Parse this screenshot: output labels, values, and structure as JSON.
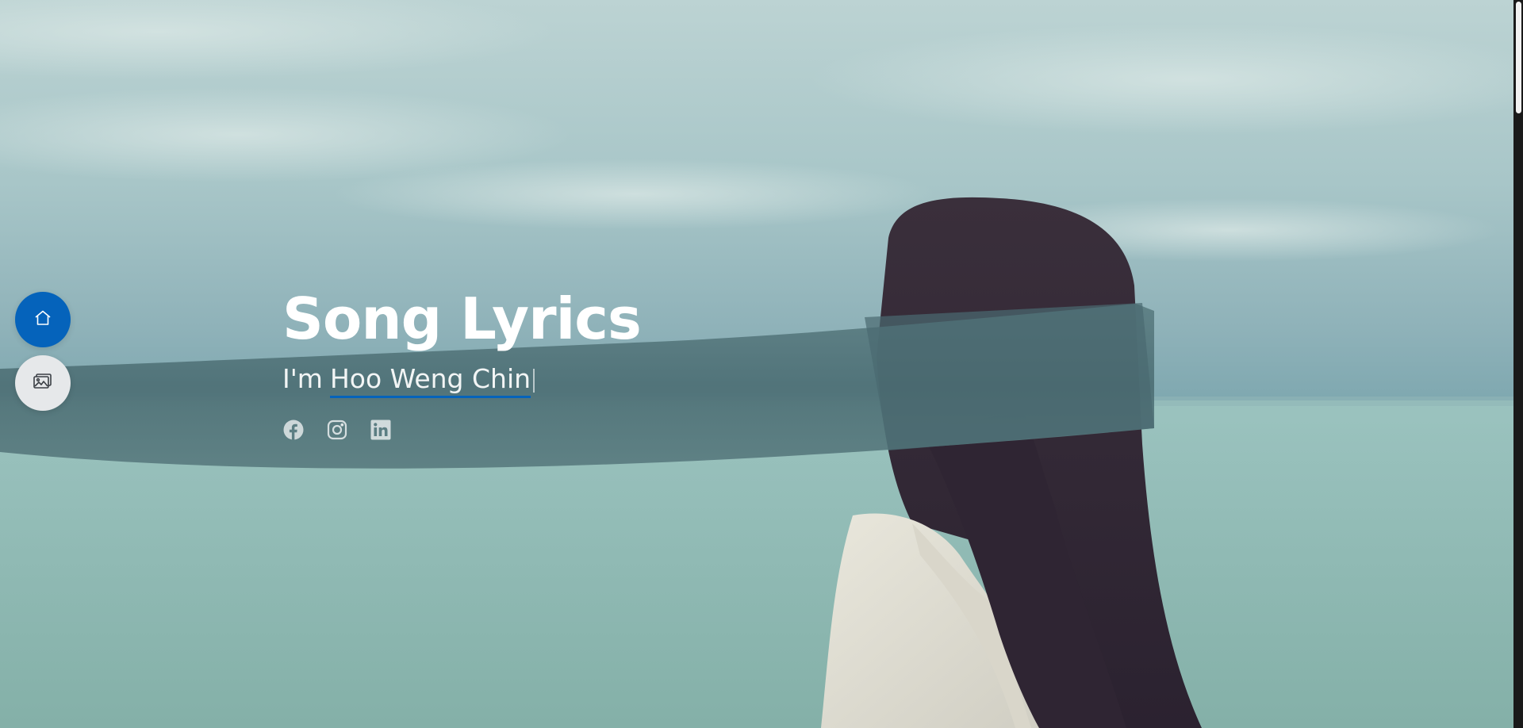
{
  "hero": {
    "title": "Song Lyrics",
    "intro_prefix": "I'm",
    "typed_name": "Hoo Weng Chin"
  },
  "nav": {
    "items": [
      {
        "icon": "home-icon",
        "active": true
      },
      {
        "icon": "gallery-icon",
        "active": false
      }
    ]
  },
  "socials": [
    "facebook-icon",
    "instagram-icon",
    "linkedin-icon"
  ],
  "colors": {
    "accent": "#0563bb",
    "text": "#ffffff",
    "nav_idle": "#e6e8ea"
  }
}
